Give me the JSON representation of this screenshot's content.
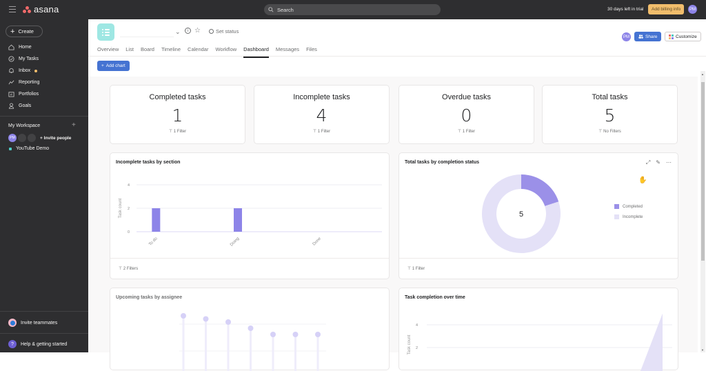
{
  "topbar": {
    "app_name": "asana",
    "search_placeholder": "Search",
    "trial_text": "30 days left in trial",
    "billing_button": "Add billing info",
    "user_initials": "PM"
  },
  "sidebar": {
    "create_label": "Create",
    "nav": [
      {
        "label": "Home",
        "icon": "home-icon"
      },
      {
        "label": "My Tasks",
        "icon": "check-circle-icon"
      },
      {
        "label": "Inbox",
        "icon": "bell-icon",
        "badge": true
      },
      {
        "label": "Reporting",
        "icon": "trend-line-icon"
      },
      {
        "label": "Portfolios",
        "icon": "folder-icon"
      },
      {
        "label": "Goals",
        "icon": "person-icon"
      }
    ],
    "workspace_title": "My Workspace",
    "member_initials": "PM",
    "invite_people": "Invite people",
    "projects": [
      {
        "label": "YouTube Demo",
        "color": "#4ecbc4"
      }
    ],
    "invite_teammates": "Invite teammates",
    "help": "Help & getting started"
  },
  "header": {
    "set_status": "Set status",
    "tabs": [
      "Overview",
      "List",
      "Board",
      "Timeline",
      "Calendar",
      "Workflow",
      "Dashboard",
      "Messages",
      "Files"
    ],
    "active_tab": "Dashboard",
    "add_chart": "Add chart",
    "share": "Share",
    "customize": "Customize",
    "share_initials": "PM"
  },
  "stats": [
    {
      "title": "Completed tasks",
      "value": "1",
      "filter": "1 Filter"
    },
    {
      "title": "Incomplete tasks",
      "value": "4",
      "filter": "1 Filter"
    },
    {
      "title": "Overdue tasks",
      "value": "0",
      "filter": "1 Filter"
    },
    {
      "title": "Total tasks",
      "value": "5",
      "filter": "No Filters"
    }
  ],
  "chart_data": [
    {
      "type": "bar",
      "title": "Incomplete tasks by section",
      "ylabel": "Task count",
      "xlabel": "",
      "categories": [
        "To do",
        "Doing",
        "Done"
      ],
      "values": [
        2,
        2,
        0
      ],
      "yticks": [
        0,
        2,
        4
      ],
      "ylim": [
        0,
        4
      ],
      "color": "#8d84e8",
      "grid": true,
      "filter": "2 Filters"
    },
    {
      "type": "pie",
      "title": "Total tasks by completion status",
      "center_label": "5",
      "categories": [
        "Completed",
        "Incomplete"
      ],
      "values": [
        1,
        4
      ],
      "colors": [
        "#9b90e8",
        "#e4e1f7"
      ],
      "legend": "right",
      "filter": "1 Filter"
    },
    {
      "type": "scatter",
      "title": "Upcoming tasks by assignee",
      "note": "lollipop chart, partially visible",
      "values": [
        7,
        6.5,
        6,
        5,
        4,
        4,
        4
      ],
      "color": "#d6d1f7"
    },
    {
      "type": "area",
      "title": "Task completion over time",
      "ylabel": "Task count",
      "yticks": [
        2,
        4
      ],
      "ylim": [
        0,
        5
      ],
      "last_value": 5,
      "color": "#e4e1f7"
    }
  ]
}
